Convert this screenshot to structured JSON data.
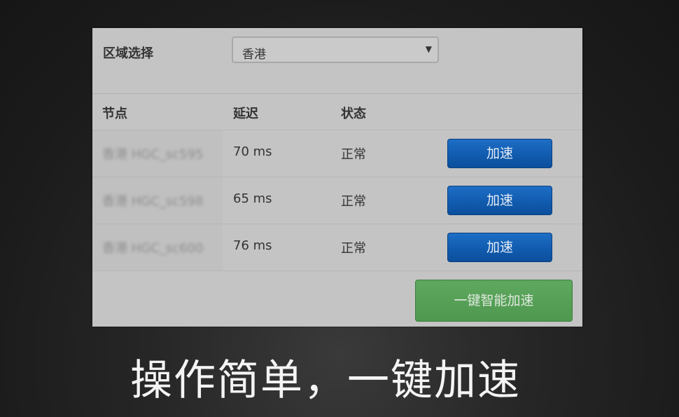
{
  "region": {
    "label": "区域选择",
    "selected": "香港",
    "caret_icon": "triangle-down-icon"
  },
  "table": {
    "headers": {
      "node": "节点",
      "latency": "延迟",
      "status": "状态"
    },
    "rows": [
      {
        "node": "香港 HGC_sc595",
        "latency": "70 ms",
        "status": "正常",
        "action": "加速"
      },
      {
        "node": "香港 HGC_sc598",
        "latency": "65 ms",
        "status": "正常",
        "action": "加速"
      },
      {
        "node": "香港 HGC_sc600",
        "latency": "76 ms",
        "status": "正常",
        "action": "加速"
      }
    ]
  },
  "one_key_button": "一键智能加速",
  "slogan": "操作简单，一键加速",
  "colors": {
    "accelerate_button": "#105aad",
    "one_key_button": "#55a055",
    "panel_background": "#c4c4c4"
  }
}
